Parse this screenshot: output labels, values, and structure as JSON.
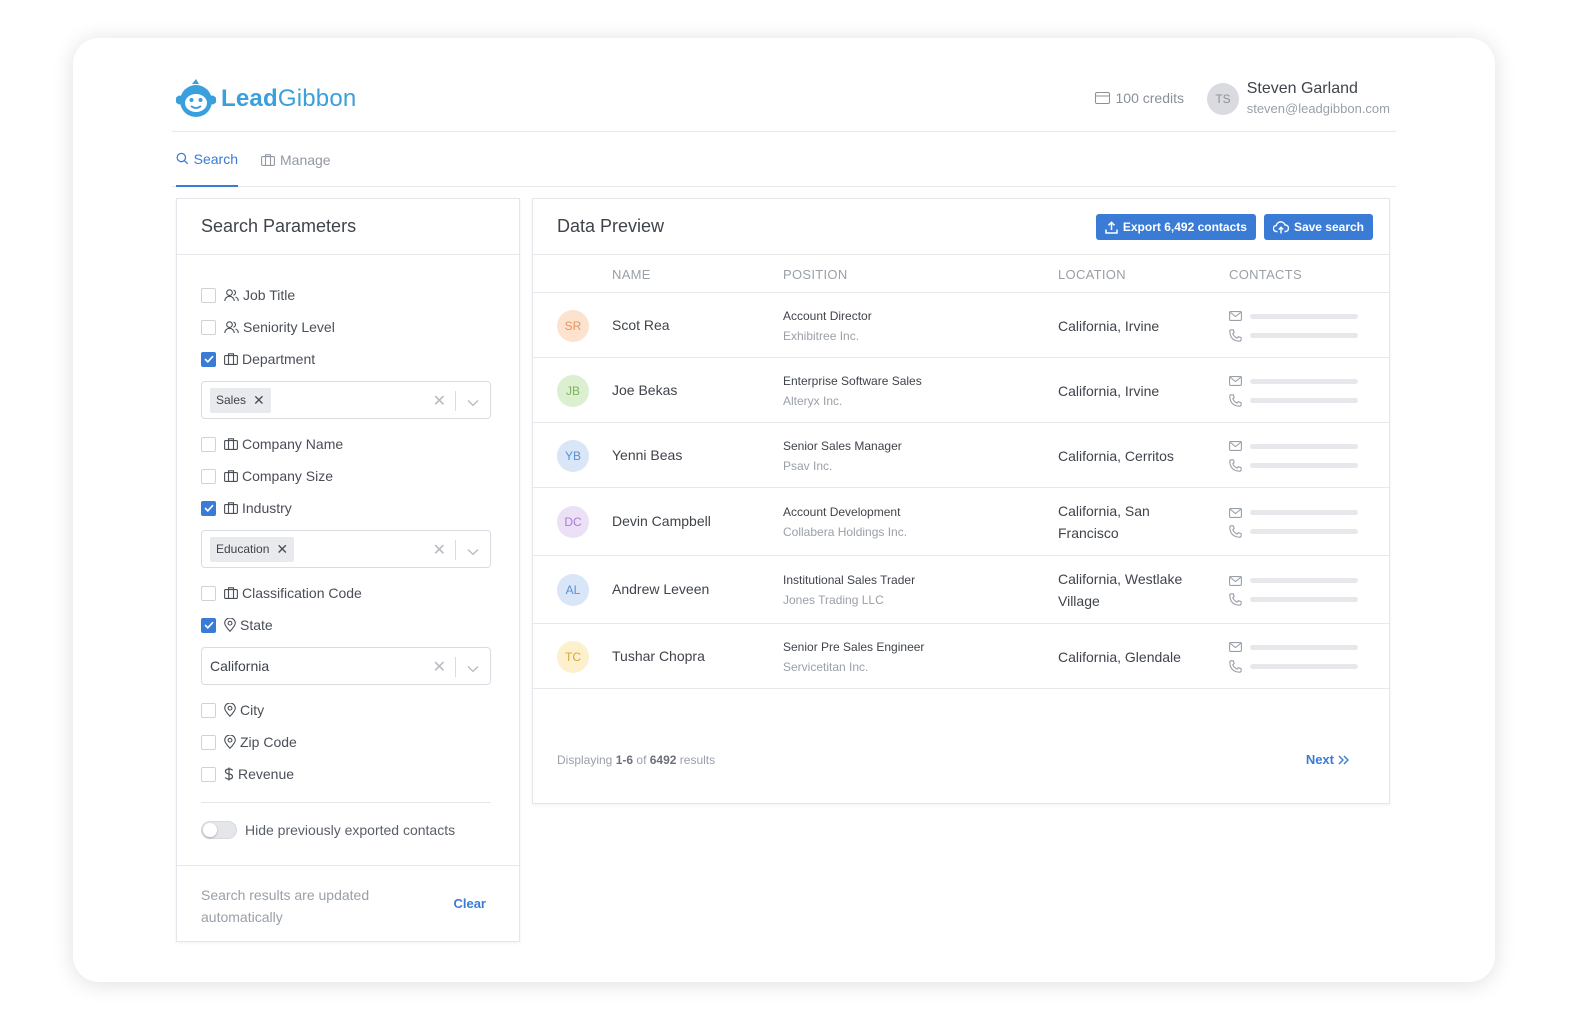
{
  "brand": {
    "name_bold": "Lead",
    "name_rest": "Gibbon",
    "color": "#3aa0dc"
  },
  "header": {
    "credits": "100 credits",
    "user_initials": "TS",
    "user_name": "Steven Garland",
    "user_email": "steven@leadgibbon.com"
  },
  "tabs": [
    {
      "label": "Search",
      "active": true
    },
    {
      "label": "Manage",
      "active": false
    }
  ],
  "search_panel": {
    "title": "Search Parameters",
    "filters": [
      {
        "label": "Job Title",
        "icon": "users-icon",
        "checked": false
      },
      {
        "label": "Seniority Level",
        "icon": "users-icon",
        "checked": false
      },
      {
        "label": "Department",
        "icon": "briefcase-icon",
        "checked": true,
        "chip": "Sales"
      },
      {
        "label": "Company Name",
        "icon": "briefcase-icon",
        "checked": false
      },
      {
        "label": "Company Size",
        "icon": "briefcase-icon",
        "checked": false
      },
      {
        "label": "Industry",
        "icon": "briefcase-icon",
        "checked": true,
        "chip": "Education"
      },
      {
        "label": "Classification Code",
        "icon": "briefcase-icon",
        "checked": false
      },
      {
        "label": "State",
        "icon": "map-pin-icon",
        "checked": true,
        "value": "California"
      },
      {
        "label": "City",
        "icon": "map-pin-icon",
        "checked": false
      },
      {
        "label": "Zip Code",
        "icon": "map-pin-icon",
        "checked": false
      },
      {
        "label": "Revenue",
        "icon": "dollar-icon",
        "checked": false
      }
    ],
    "toggle_label": "Hide previously exported contacts",
    "toggle_on": false,
    "footer_note": "Search results are updated automatically",
    "clear_label": "Clear"
  },
  "preview": {
    "title": "Data Preview",
    "export_label": "Export 6,492 contacts",
    "save_label": "Save search",
    "columns": {
      "name": "NAME",
      "position": "POSITION",
      "location": "LOCATION",
      "contacts": "CONTACTS"
    },
    "rows": [
      {
        "initials": "SR",
        "name": "Scot Rea",
        "title": "Account Director",
        "company": "Exhibitree Inc.",
        "location": "California, Irvine",
        "avatar_bg": "#fde3cf",
        "avatar_fg": "#e8935b"
      },
      {
        "initials": "JB",
        "name": "Joe Bekas",
        "title": "Enterprise Software Sales",
        "company": "Alteryx Inc.",
        "location": "California, Irvine",
        "avatar_bg": "#dcefd0",
        "avatar_fg": "#7bb55a"
      },
      {
        "initials": "YB",
        "name": "Yenni Beas",
        "title": "Senior Sales Manager",
        "company": "Psav Inc.",
        "location": "California, Cerritos",
        "avatar_bg": "#d8e6f8",
        "avatar_fg": "#5b8fd6"
      },
      {
        "initials": "DC",
        "name": "Devin Campbell",
        "title": "Account Development",
        "company": "Collabera Holdings Inc.",
        "location": "California, San Francisco",
        "avatar_bg": "#ece0f7",
        "avatar_fg": "#a77cd8"
      },
      {
        "initials": "AL",
        "name": "Andrew Leveen",
        "title": "Institutional Sales Trader",
        "company": "Jones Trading LLC",
        "location": "California, Westlake Village",
        "avatar_bg": "#d8e6f8",
        "avatar_fg": "#5b8fd6"
      },
      {
        "initials": "TC",
        "name": "Tushar Chopra",
        "title": "Senior Pre Sales Engineer",
        "company": "Servicetitan Inc.",
        "location": "California, Glendale",
        "avatar_bg": "#fdf0cc",
        "avatar_fg": "#d8a93a"
      }
    ],
    "pager": {
      "prefix": "Displaying",
      "range": "1-6",
      "of": "of",
      "total": "6492",
      "suffix": "results"
    },
    "next_label": "Next"
  }
}
